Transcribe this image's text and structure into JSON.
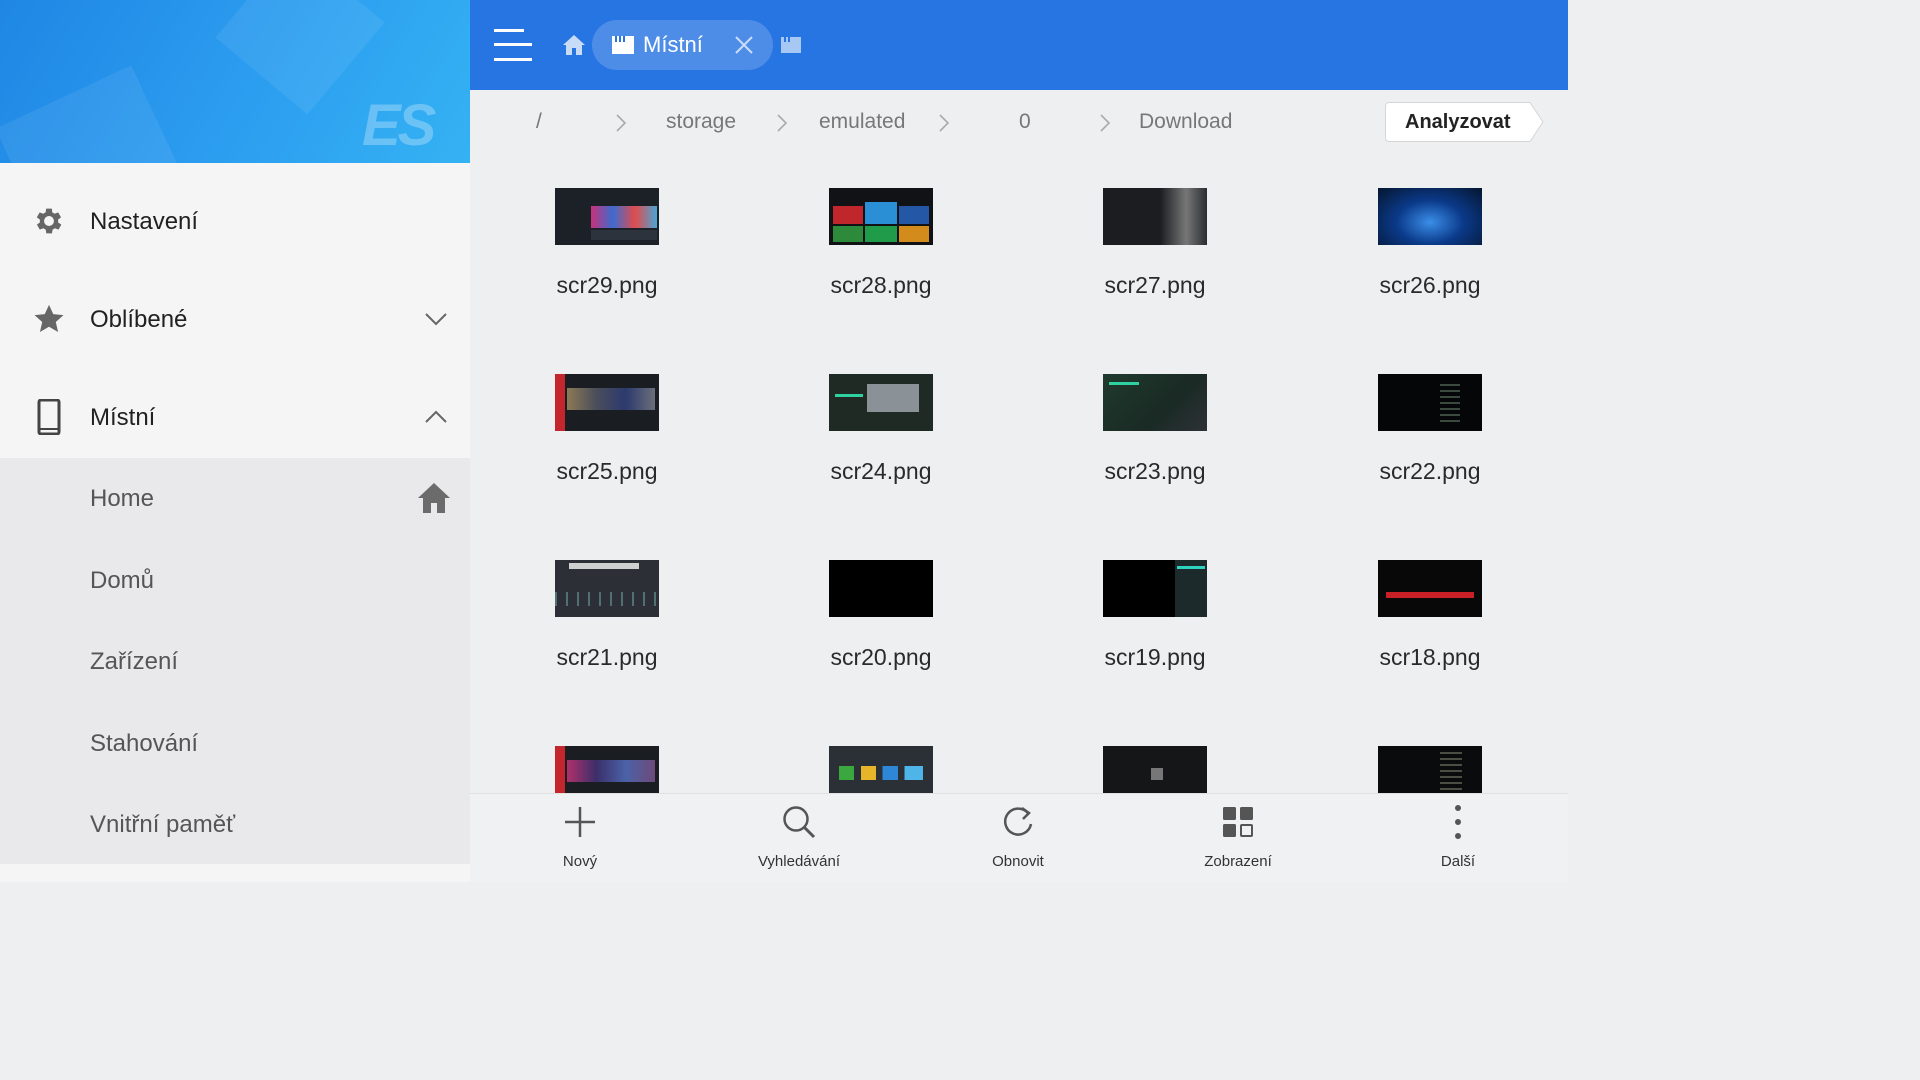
{
  "colors": {
    "topbar": "#2675e3",
    "sidebar_header_gradient": [
      "#1f86e4",
      "#35b2f3"
    ],
    "sidebar_bg": "#f5f5f5",
    "submenu_bg": "#e9e9eb",
    "content_bg": "#eeeff1",
    "icon_gray": "#666666"
  },
  "sidebar": {
    "logo_text": "ES",
    "items": [
      {
        "label": "Nastavení",
        "icon": "gear-icon"
      },
      {
        "label": "Oblíbené",
        "icon": "star-icon",
        "chevron": "chevron-down-icon"
      },
      {
        "label": "Místní",
        "icon": "phone-icon",
        "chevron": "chevron-up-icon"
      }
    ],
    "subitems": [
      {
        "label": "Home",
        "icon": "home-icon"
      },
      {
        "label": "Domů"
      },
      {
        "label": "Zařízení"
      },
      {
        "label": "Stahování"
      },
      {
        "label": "Vnitřní paměť"
      }
    ]
  },
  "topbar": {
    "menu_icon": "hamburger-menu-icon",
    "home_icon": "home-icon",
    "tab": {
      "label": "Místní",
      "icon": "sd-card-icon",
      "close_icon": "close-icon"
    },
    "new_tab_icon": "new-tab-icon"
  },
  "breadcrumb": {
    "segments": [
      "/",
      "storage",
      "emulated",
      "0",
      "Download"
    ],
    "analyze_label": "Analyzovat"
  },
  "files": [
    {
      "name": "scr29.png",
      "thumb": "tv-ui-colorful"
    },
    {
      "name": "scr28.png",
      "thumb": "tv-tiles"
    },
    {
      "name": "scr27.png",
      "thumb": "dark-gray"
    },
    {
      "name": "scr26.png",
      "thumb": "blue-burst"
    },
    {
      "name": "scr25.png",
      "thumb": "tv-ui-red"
    },
    {
      "name": "scr24.png",
      "thumb": "green-dialog"
    },
    {
      "name": "scr23.png",
      "thumb": "green-list"
    },
    {
      "name": "scr22.png",
      "thumb": "black-list"
    },
    {
      "name": "scr21.png",
      "thumb": "gray-dots"
    },
    {
      "name": "scr20.png",
      "thumb": "black"
    },
    {
      "name": "scr19.png",
      "thumb": "black-side"
    },
    {
      "name": "scr18.png",
      "thumb": "red-bar"
    },
    {
      "name": "",
      "thumb": "tv-ui-red"
    },
    {
      "name": "",
      "thumb": "app-icons"
    },
    {
      "name": "",
      "thumb": "dark-center"
    },
    {
      "name": "",
      "thumb": "black-list"
    }
  ],
  "bottombar": [
    {
      "label": "Nový",
      "icon": "plus-icon"
    },
    {
      "label": "Vyhledávání",
      "icon": "search-icon"
    },
    {
      "label": "Obnovit",
      "icon": "refresh-icon"
    },
    {
      "label": "Zobrazení",
      "icon": "grid-view-icon"
    },
    {
      "label": "Další",
      "icon": "more-vertical-icon"
    }
  ]
}
